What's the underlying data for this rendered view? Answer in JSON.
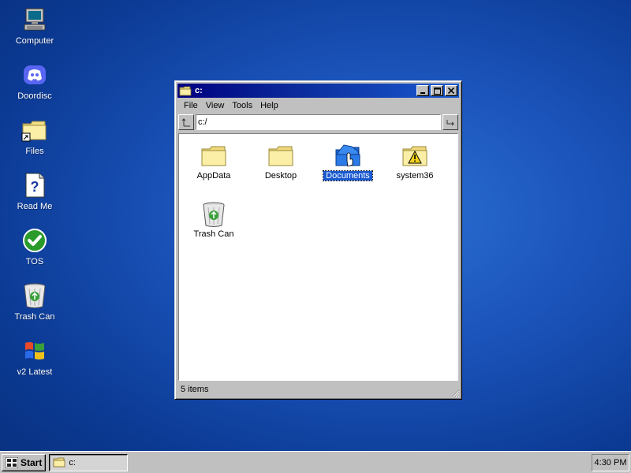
{
  "desktop": {
    "icons": [
      {
        "label": "Computer",
        "icon": "computer-icon"
      },
      {
        "label": "Doordisc",
        "icon": "discord-icon"
      },
      {
        "label": "Files",
        "icon": "folder-shortcut-icon"
      },
      {
        "label": "Read Me",
        "icon": "help-document-icon"
      },
      {
        "label": "TOS",
        "icon": "checkmark-icon"
      },
      {
        "label": "Trash Can",
        "icon": "recycle-bin-icon"
      },
      {
        "label": "v2 Latest",
        "icon": "windows-logo-icon"
      }
    ]
  },
  "window": {
    "title": "c:",
    "menu": [
      "File",
      "View",
      "Tools",
      "Help"
    ],
    "address": "c:/",
    "files": [
      {
        "label": "AppData",
        "icon": "folder-icon",
        "selected": false
      },
      {
        "label": "Desktop",
        "icon": "folder-icon",
        "selected": false
      },
      {
        "label": "Documents",
        "icon": "folder-open-blue-icon",
        "selected": true
      },
      {
        "label": "system36",
        "icon": "folder-warning-icon",
        "selected": false
      },
      {
        "label": "Trash Can",
        "icon": "recycle-bin-icon",
        "selected": false
      }
    ],
    "status": "5 items"
  },
  "taskbar": {
    "start_label": "Start",
    "task_label": "c:",
    "clock": "4:30 PM"
  },
  "colors": {
    "desktop_blue": "#1a52b8",
    "titlebar_blue": "#000080",
    "selection_blue": "#1a5ad0",
    "chrome_gray": "#c0c0c0"
  }
}
